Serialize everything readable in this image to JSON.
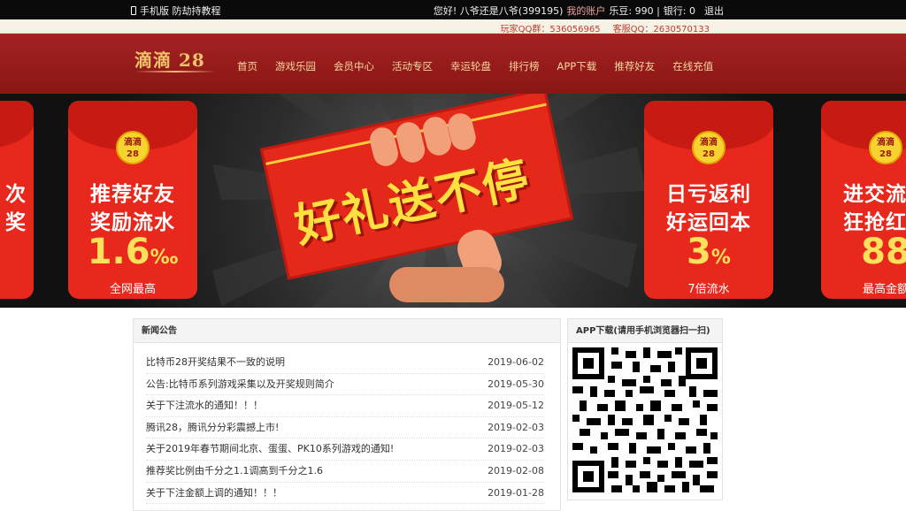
{
  "topbar": {
    "mobile_link": "手机版 防劫持教程",
    "greeting": "您好! 八爷还是八爷(399195)",
    "my_account": "我的账户",
    "ledou_label": "乐豆: 990 |",
    "bank_label": "银行: 0",
    "logout": "退出"
  },
  "subbar": {
    "qq_group": "玩家QQ群：536056965",
    "service_qq": "客服QQ：2630570133"
  },
  "nav": {
    "logo": "滴滴 28",
    "items": [
      "首页",
      "游戏乐园",
      "会员中心",
      "活动专区",
      "幸运轮盘",
      "排行榜",
      "APP下载",
      "推荐好友",
      "在线充值"
    ]
  },
  "banner": {
    "center_text": "好礼送不停",
    "cards": [
      {
        "coin": "滴滴 28",
        "line1": "推荐好友",
        "line2": "奖励流水",
        "big": "1.6",
        "unit": "‰",
        "foot": "全网最高"
      },
      {
        "coin": "滴滴 28",
        "line1": "日亏返利",
        "line2": "好运回本",
        "big": "3",
        "unit": "%",
        "foot": "7倍流水"
      },
      {
        "coin": "滴滴 28",
        "line1": "进交流群",
        "line2": "狂抢红包",
        "big": "88",
        "unit": "",
        "foot": "最高金额"
      }
    ],
    "partial_left": {
      "line1": "次",
      "line2": "奖"
    }
  },
  "news": {
    "title": "新闻公告",
    "items": [
      {
        "title": "比特币28开奖结果不一致的说明",
        "date": "2019-06-02"
      },
      {
        "title": "公告:比特币系列游戏采集以及开奖规则简介",
        "date": "2019-05-30"
      },
      {
        "title": "关于下注流水的通知！！！",
        "date": "2019-05-12"
      },
      {
        "title": "腾讯28，腾讯分分彩震撼上市!",
        "date": "2019-02-03"
      },
      {
        "title": "关于2019年春节期间北京、蛋蛋、PK10系列游戏的通知!",
        "date": "2019-02-03"
      },
      {
        "title": "推荐奖比例由千分之1.1调高到千分之1.6",
        "date": "2019-02-08"
      },
      {
        "title": "关于下注金额上调的通知！！！",
        "date": "2019-01-28"
      }
    ]
  },
  "app": {
    "title": "APP下载(请用手机浏览器扫一扫)"
  },
  "colors": {
    "nav_bg": "#9a1c1c",
    "nav_text": "#f7d6a0",
    "card_red": "#e8281c",
    "gold": "#ffe05a"
  }
}
